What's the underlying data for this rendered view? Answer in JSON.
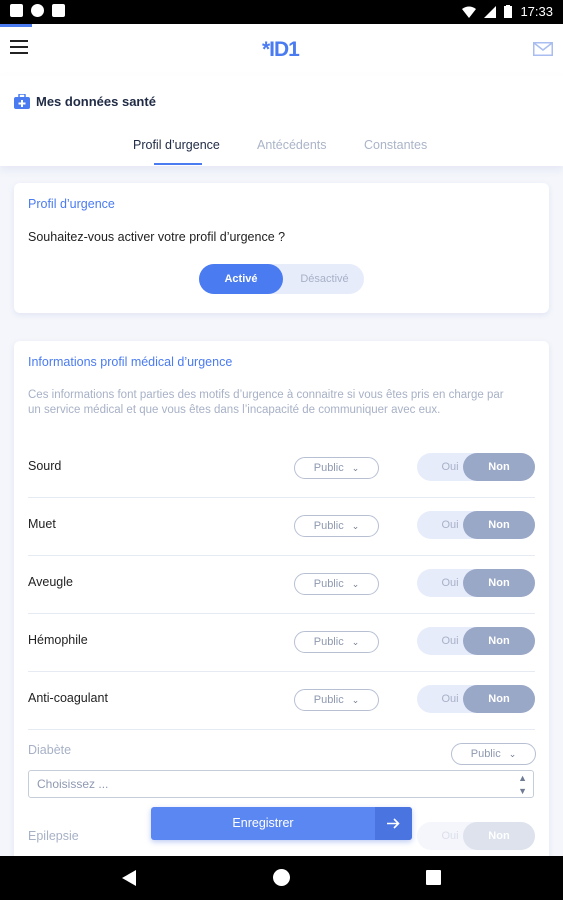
{
  "status_bar": {
    "time": "17:33"
  },
  "app": {
    "logo": "*ID1",
    "accent_color": "#4a7bf0"
  },
  "page": {
    "title": "Mes données santé",
    "title_icon": "medical-kit-icon",
    "tabs": [
      {
        "label": "Profil d’urgence",
        "active": true
      },
      {
        "label": "Antécédents",
        "active": false
      },
      {
        "label": "Constantes",
        "active": false
      }
    ]
  },
  "emergency_card": {
    "title": "Profil d’urgence",
    "question": "Souhaitez-vous activer votre profil d’urgence ?",
    "toggle_on": "Activé",
    "toggle_off": "Désactivé",
    "selected": "Activé"
  },
  "medical_card": {
    "title": "Informations profil médical d’urgence",
    "description": "Ces informations font parties des motifs d’urgence à connaitre si vous êtes pris en charge par un service médical et que vous êtes dans l’incapacité de communiquer avec eux.",
    "rows": [
      {
        "label": "Sourd",
        "visibility": "Public",
        "yes": "Oui",
        "no": "Non",
        "value": "Non"
      },
      {
        "label": "Muet",
        "visibility": "Public",
        "yes": "Oui",
        "no": "Non",
        "value": "Non"
      },
      {
        "label": "Aveugle",
        "visibility": "Public",
        "yes": "Oui",
        "no": "Non",
        "value": "Non"
      },
      {
        "label": "Hémophile",
        "visibility": "Public",
        "yes": "Oui",
        "no": "Non",
        "value": "Non"
      },
      {
        "label": "Anti-coagulant",
        "visibility": "Public",
        "yes": "Oui",
        "no": "Non",
        "value": "Non"
      }
    ],
    "diabetes": {
      "label": "Diabète",
      "visibility": "Public",
      "placeholder": "Choisissez ..."
    },
    "epilepsy": {
      "label": "Epilepsie",
      "yes": "Oui",
      "no": "Non"
    }
  },
  "save_button": {
    "label": "Enregistrer"
  }
}
